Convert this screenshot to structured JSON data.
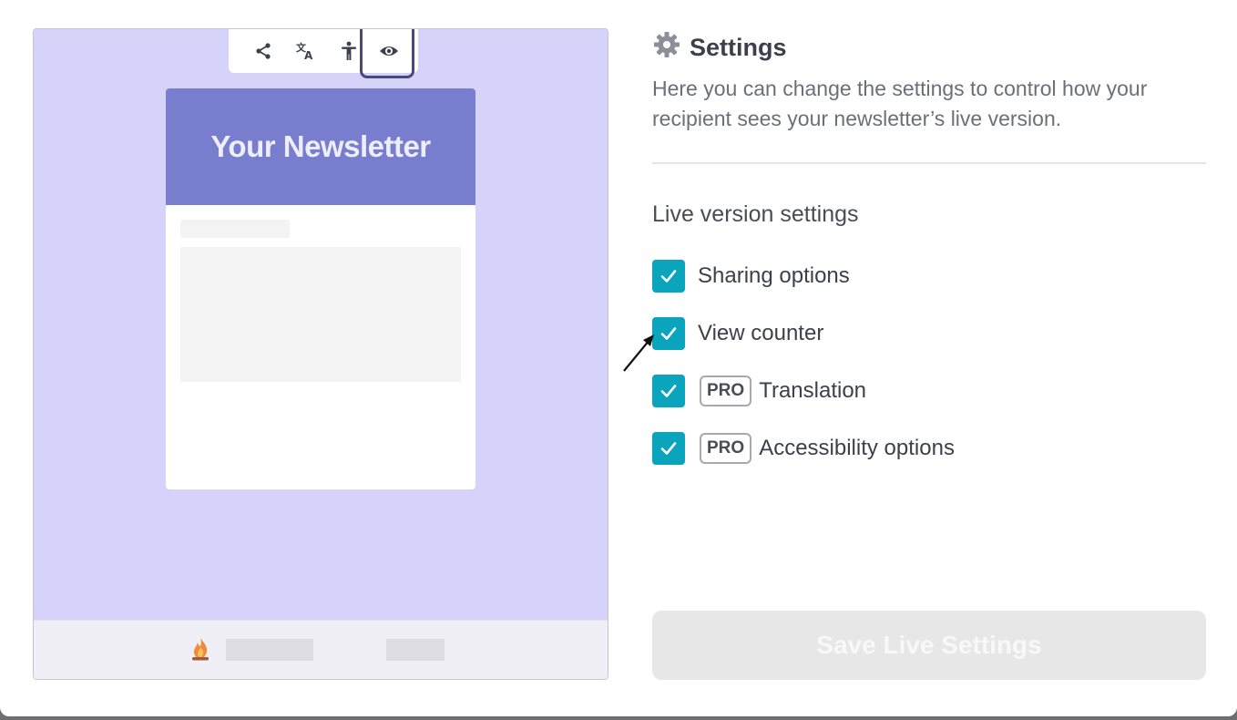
{
  "preview": {
    "toolbar": {
      "icons": [
        "share-icon",
        "translate-icon",
        "accessibility-icon",
        "eye-icon"
      ],
      "highlighted": "eye-icon"
    },
    "newsletter_title": "Your Newsletter",
    "footer_icon": "fire-icon"
  },
  "settings": {
    "title": "Settings",
    "title_icon": "gear-icon",
    "description": "Here you can change the settings to control how your recipient sees your newsletter’s live version.",
    "section_heading": "Live version settings",
    "options": [
      {
        "label": "Sharing options",
        "checked": true,
        "pro": false
      },
      {
        "label": "View counter",
        "checked": true,
        "pro": false
      },
      {
        "label": "Translation",
        "checked": true,
        "pro": true
      },
      {
        "label": "Accessibility options",
        "checked": true,
        "pro": true
      }
    ],
    "pro_badge": "PRO",
    "save_label": "Save Live Settings"
  },
  "colors": {
    "preview_bg": "#d5d3f9",
    "newsletter_header": "#787dcd",
    "checkbox": "#0aa4bd",
    "highlight_border": "#474a78",
    "save_disabled_bg": "#e7e7e8"
  }
}
